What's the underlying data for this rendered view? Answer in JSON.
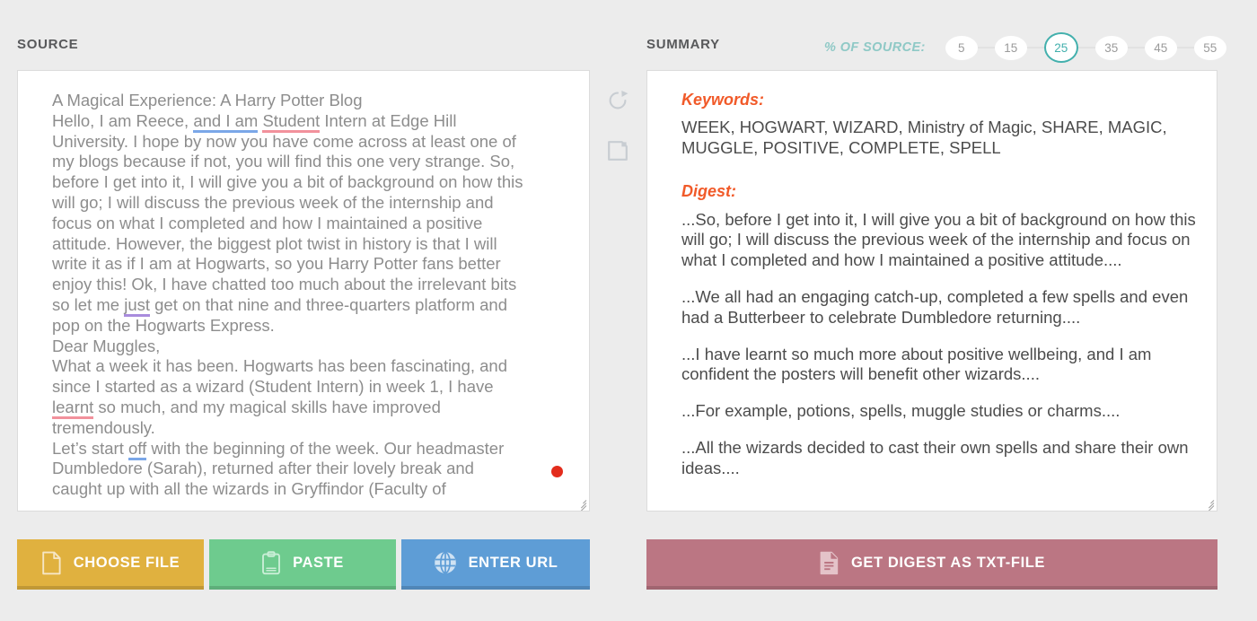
{
  "source_panel": {
    "title": "SOURCE",
    "text_lines": [
      "A Magical Experience: A Harry Potter Blog",
      "Hello, I am Reece, and I am Student Intern at Edge Hill",
      "University. I hope by now you have come across at least one of",
      "my blogs because if not, you will find this one very strange. So,",
      "before I get into it, I will give you a bit of background on how this",
      "will go; I will discuss the previous week of the internship and",
      "focus on what I completed and how I maintained a positive",
      "attitude. However, the biggest plot twist in history is that I will",
      "write it as if I am at Hogwarts, so you Harry Potter fans better",
      "enjoy this! Ok, I have chatted too much about the irrelevant bits",
      "so let me just get on that nine and three-quarters platform and",
      "pop on the Hogwarts Express.",
      "Dear Muggles,",
      "What a week it has been. Hogwarts has been fascinating, and",
      "since I started as a wizard (Student Intern) in week 1, I have",
      "learnt so much, and my magical skills have improved",
      "tremendously.",
      "Let’s start off with the beginning of the week. Our headmaster",
      "Dumbledore (Sarah), returned after their lovely break and",
      "caught up with all the wizards in Gryffindor (Faculty of"
    ],
    "annotations": [
      {
        "text": "and I am",
        "color": "#7ba7e8",
        "style": "underline-blue"
      },
      {
        "text": "Student",
        "color": "#f2919c",
        "style": "underline-pink"
      },
      {
        "text": "just",
        "color": "#a98cdd",
        "style": "underline-purple"
      },
      {
        "text": "learnt",
        "color": "#f2919c",
        "style": "underline-pink"
      },
      {
        "text": "off",
        "color": "#7ba7e8",
        "style": "underline-blue"
      },
      {
        "text": "",
        "color": "#e32c1c",
        "style": "red-dot-marker"
      }
    ]
  },
  "summary_panel": {
    "title": "SUMMARY",
    "percent_label": "% OF SOURCE:",
    "percent_options": [
      "5",
      "15",
      "25",
      "35",
      "45",
      "55"
    ],
    "percent_selected": "25",
    "keywords_heading": "Keywords:",
    "keywords": "WEEK, HOGWART, WIZARD, Ministry of Magic, SHARE, MAGIC, MUGGLE, POSITIVE, COMPLETE, SPELL",
    "digest_heading": "Digest:",
    "digest_paragraphs": [
      "...So, before I get into it, I will give you a bit of background on how this will go; I will discuss the previous week of the internship and focus on what I completed and how I maintained a positive attitude....",
      "...We all had an engaging catch-up, completed a few spells and even had a Butterbeer to celebrate Dumbledore returning....",
      "...I have learnt so much more about positive wellbeing, and I am confident the posters will benefit other wizards....",
      "...For example, potions, spells, muggle studies or charms....",
      "...All the wizards decided to cast their own spells and share their own ideas...."
    ]
  },
  "middle_tools": {
    "refresh_icon": "refresh-icon",
    "new_page_icon": "new-page-icon"
  },
  "buttons": {
    "choose_file": "CHOOSE FILE",
    "paste": "PASTE",
    "enter_url": "ENTER URL",
    "get_digest": "GET DIGEST AS TXT-FILE"
  },
  "colors": {
    "page_background": "#ececec",
    "accent_teal": "#43b0ad",
    "label_teal": "#8fc9c6",
    "heading_orange": "#f15a29",
    "choose_file": "#e0b13f",
    "paste": "#6ecb8e",
    "enter_url": "#5e9dd6",
    "get_digest": "#bb7683",
    "source_text": "#8d8d8d",
    "summary_text": "#4c4c4c",
    "red_marker": "#e32c1c"
  }
}
